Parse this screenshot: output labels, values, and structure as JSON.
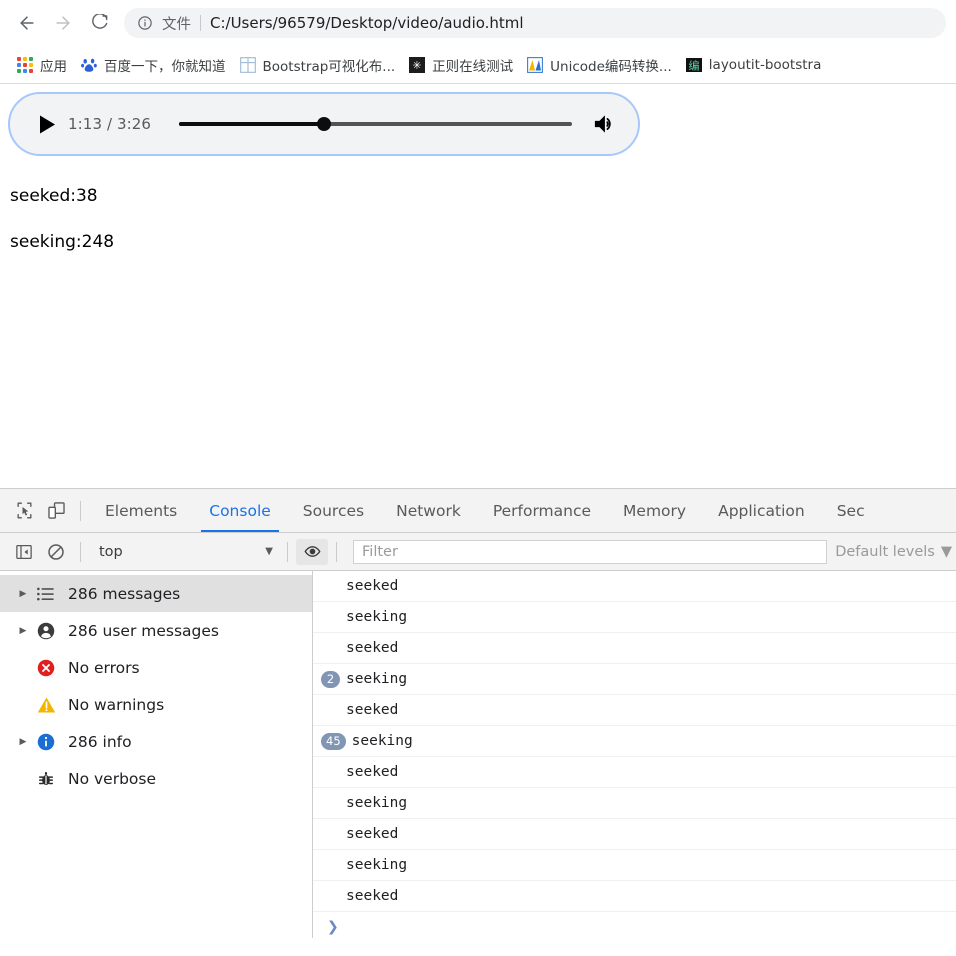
{
  "browser": {
    "nav": {
      "back_label": "back-arrow",
      "forward_label": "forward-arrow",
      "reload_label": "reload"
    },
    "omnibox": {
      "info_icon": "info-circle-icon",
      "scheme_label": "文件",
      "url": "C:/Users/96579/Desktop/video/audio.html"
    },
    "bookmarks": [
      {
        "label": "应用",
        "icon": "apps-grid-icon"
      },
      {
        "label": "百度一下，你就知道",
        "icon": "baidu-icon"
      },
      {
        "label": "Bootstrap可视化布...",
        "icon": "bootstrap-grid-icon"
      },
      {
        "label": "正则在线测试",
        "icon": "regex-icon"
      },
      {
        "label": "Unicode编码转换...",
        "icon": "unicode-icon"
      },
      {
        "label": "layoutit-bootstra",
        "icon": "layoutit-icon"
      }
    ]
  },
  "page": {
    "audio_player": {
      "play_icon": "play-icon",
      "current_time": "1:13",
      "duration": "3:26",
      "time_display": "1:13 / 3:26",
      "progress_percent": 37,
      "volume_icon": "volume-high-icon"
    },
    "lines": [
      "seeked:38",
      "seeking:248"
    ]
  },
  "devtools": {
    "toolbar_icons": {
      "inspect": "inspect-element-icon",
      "device": "device-toolbar-icon"
    },
    "tabs": [
      {
        "label": "Elements",
        "active": false
      },
      {
        "label": "Console",
        "active": true
      },
      {
        "label": "Sources",
        "active": false
      },
      {
        "label": "Network",
        "active": false
      },
      {
        "label": "Performance",
        "active": false
      },
      {
        "label": "Memory",
        "active": false
      },
      {
        "label": "Application",
        "active": false
      },
      {
        "label": "Sec",
        "active": false
      }
    ],
    "console_toolbar": {
      "sidebar_toggle_icon": "console-sidebar-toggle-icon",
      "clear_icon": "clear-console-icon",
      "context_selected": "top",
      "context_caret": "▼",
      "eye_icon": "live-expression-eye-icon",
      "filter_placeholder": "Filter",
      "filter_value": "",
      "levels_label": "Default levels",
      "levels_caret": "▼"
    },
    "sidebar": [
      {
        "label": "286 messages",
        "icon": "list-icon",
        "arrow": true,
        "selected": true
      },
      {
        "label": "286 user messages",
        "icon": "user-icon",
        "arrow": true,
        "selected": false
      },
      {
        "label": "No errors",
        "icon": "error-icon",
        "arrow": false,
        "selected": false
      },
      {
        "label": "No warnings",
        "icon": "warning-icon",
        "arrow": false,
        "selected": false
      },
      {
        "label": "286 info",
        "icon": "info-icon",
        "arrow": true,
        "selected": false
      },
      {
        "label": "No verbose",
        "icon": "verbose-bug-icon",
        "arrow": false,
        "selected": false
      }
    ],
    "messages": [
      {
        "badge": "",
        "text": "seeked"
      },
      {
        "badge": "",
        "text": "seeking"
      },
      {
        "badge": "",
        "text": "seeked"
      },
      {
        "badge": "2",
        "text": "seeking"
      },
      {
        "badge": "",
        "text": "seeked"
      },
      {
        "badge": "45",
        "text": "seeking"
      },
      {
        "badge": "",
        "text": "seeked"
      },
      {
        "badge": "",
        "text": "seeking"
      },
      {
        "badge": "",
        "text": "seeked"
      },
      {
        "badge": "",
        "text": "seeking"
      },
      {
        "badge": "",
        "text": "seeked"
      }
    ],
    "prompt_caret": "❯"
  },
  "colors": {
    "accent": "#1a73e8",
    "focus_ring": "#a8c7fa",
    "badge": "#8196b5",
    "error": "#e02020",
    "warning": "#f2b600",
    "info": "#1a6fd4",
    "toolbar_bg": "#f3f3f3"
  }
}
